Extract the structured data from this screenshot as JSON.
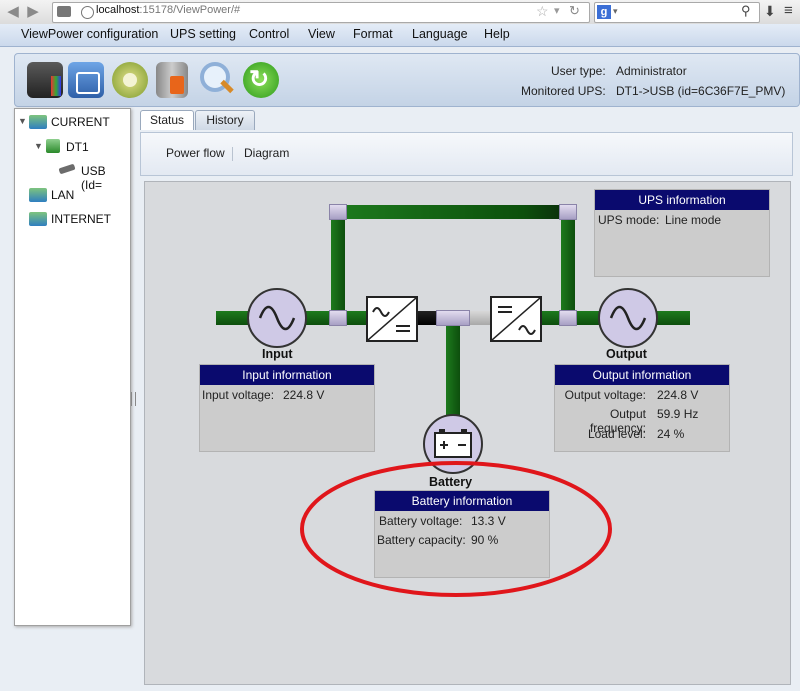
{
  "browser": {
    "url_host": "localhost",
    "url_path": ":15178/ViewPower/#",
    "search_engine": "g"
  },
  "menu": [
    "ViewPower configuration",
    "UPS setting",
    "Control",
    "View",
    "Format",
    "Language",
    "Help"
  ],
  "header": {
    "user_type_label": "User type:",
    "user_type_value": "Administrator",
    "monitored_label": "Monitored UPS:",
    "monitored_value": "DT1->USB (id=6C36F7E_PMV)"
  },
  "tree": {
    "current": "CURRENT",
    "dt1": "DT1",
    "usb": "USB (Id=",
    "lan": "LAN",
    "internet": "INTERNET"
  },
  "tabs": [
    "Status",
    "History"
  ],
  "subtabs": [
    "Power flow",
    "Diagram"
  ],
  "flow": {
    "input_label": "Input",
    "output_label": "Output",
    "battery_label": "Battery"
  },
  "ups_info": {
    "title": "UPS information",
    "mode_label": "UPS mode:",
    "mode_value": "Line mode"
  },
  "input_info": {
    "title": "Input information",
    "voltage_label": "Input voltage:",
    "voltage_value": "224.8 V"
  },
  "output_info": {
    "title": "Output information",
    "voltage_label": "Output voltage:",
    "voltage_value": "224.8 V",
    "frequency_label": "Output frequency:",
    "frequency_value": "59.9 Hz",
    "load_label": "Load level:",
    "load_value": "24 %"
  },
  "battery_info": {
    "title": "Battery information",
    "voltage_label": "Battery voltage:",
    "voltage_value": "13.3 V",
    "capacity_label": "Battery capacity:",
    "capacity_value": "90 %"
  },
  "colors": {
    "pipe_active": "#1d7a1d",
    "pipe_inactive": "#c0c0c0",
    "info_header": "#0a0a6e",
    "highlight_ring": "#e0161b"
  }
}
